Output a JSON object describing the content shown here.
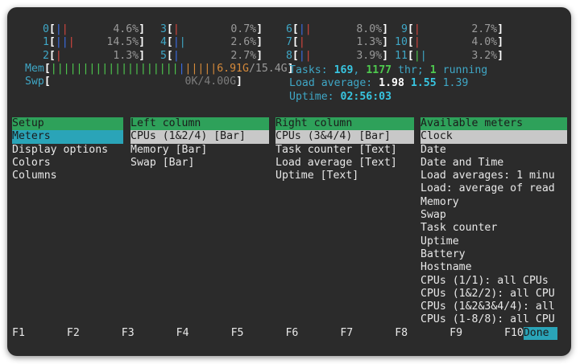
{
  "cpus": [
    {
      "id": "0",
      "pct": "4.6%",
      "bars": [
        {
          "c": "#3b6ee5",
          "n": 1
        },
        {
          "c": "#d5463f",
          "n": 1
        }
      ]
    },
    {
      "id": "1",
      "pct": "14.5%",
      "bars": [
        {
          "c": "#3b6ee5",
          "n": 2
        },
        {
          "c": "#d5463f",
          "n": 1
        }
      ]
    },
    {
      "id": "2",
      "pct": "1.3%",
      "bars": [
        {
          "c": "#d5463f",
          "n": 1
        }
      ]
    },
    {
      "id": "3",
      "pct": "0.7%",
      "bars": [
        {
          "c": "#d5463f",
          "n": 1
        }
      ]
    },
    {
      "id": "4",
      "pct": "2.6%",
      "bars": [
        {
          "c": "#3b6ee5",
          "n": 1
        },
        {
          "c": "#3fa7c6",
          "n": 1
        }
      ]
    },
    {
      "id": "5",
      "pct": "2.7%",
      "bars": [
        {
          "c": "#3b6ee5",
          "n": 1
        }
      ]
    },
    {
      "id": "6",
      "pct": "8.0%",
      "bars": [
        {
          "c": "#3b6ee5",
          "n": 1
        },
        {
          "c": "#d5463f",
          "n": 1
        }
      ]
    },
    {
      "id": "7",
      "pct": "1.3%",
      "bars": [
        {
          "c": "#d5463f",
          "n": 1
        }
      ]
    },
    {
      "id": "8",
      "pct": "3.9%",
      "bars": [
        {
          "c": "#3b6ee5",
          "n": 1
        },
        {
          "c": "#d5463f",
          "n": 1
        }
      ]
    },
    {
      "id": "9",
      "pct": "2.7%",
      "bars": [
        {
          "c": "#d5463f",
          "n": 1
        }
      ]
    },
    {
      "id": "10",
      "pct": "4.0%",
      "bars": [
        {
          "c": "#d5463f",
          "n": 1
        }
      ]
    },
    {
      "id": "11",
      "pct": "3.2%",
      "bars": [
        {
          "c": "#4ec94e",
          "n": 1
        },
        {
          "c": "#3fa7c6",
          "n": 1
        }
      ]
    }
  ],
  "mem": {
    "label": "Mem",
    "used": "6.91G",
    "total": "/15.4G",
    "bars": [
      {
        "c": "#4ec94e",
        "n": 20
      },
      {
        "c": "#3b6ee5",
        "n": 1
      },
      {
        "c": "#d68a3a",
        "n": 5
      }
    ]
  },
  "swp": {
    "label": "Swp",
    "value": "0K/4.00G"
  },
  "tasks": {
    "label": "Tasks:",
    "count": "169",
    "sep1": ",",
    "thr": "1177",
    "thr_label": "thr;",
    "running": "1",
    "running_label": "running"
  },
  "load": {
    "label": "Load average:",
    "l1": "1.98",
    "l5": "1.55",
    "l15": "1.39"
  },
  "uptime": {
    "label": "Uptime:",
    "value": "02:56:03"
  },
  "setup": {
    "header": "Setup",
    "items": [
      "Meters",
      "Display options",
      "Colors",
      "Columns"
    ]
  },
  "left_column": {
    "header": "Left column",
    "items": [
      "CPUs (1&2/4) [Bar]",
      "Memory [Bar]",
      "Swap [Bar]"
    ]
  },
  "right_column": {
    "header": "Right column",
    "items": [
      "CPUs (3&4/4) [Bar]",
      "Task counter [Text]",
      "Load average [Text]",
      "Uptime [Text]"
    ]
  },
  "available": {
    "header": "Available meters",
    "items": [
      "Clock",
      "Date",
      "Date and Time",
      "Load averages: 1 minu",
      "Load: average of read",
      "Memory",
      "Swap",
      "Task counter",
      "Uptime",
      "Battery",
      "Hostname",
      "CPUs (1/1): all CPUs",
      "CPUs (1&2/2): all CPU",
      "CPUs (1&2&3&4/4): all",
      "CPUs (1-8/8): all CPU"
    ]
  },
  "fkeys": [
    {
      "key": "F1",
      "label": ""
    },
    {
      "key": "F2",
      "label": ""
    },
    {
      "key": "F3",
      "label": ""
    },
    {
      "key": "F4",
      "label": ""
    },
    {
      "key": "F5",
      "label": ""
    },
    {
      "key": "F6",
      "label": ""
    },
    {
      "key": "F7",
      "label": ""
    },
    {
      "key": "F8",
      "label": ""
    },
    {
      "key": "F9",
      "label": ""
    },
    {
      "key": "F10",
      "label": "Done"
    }
  ]
}
